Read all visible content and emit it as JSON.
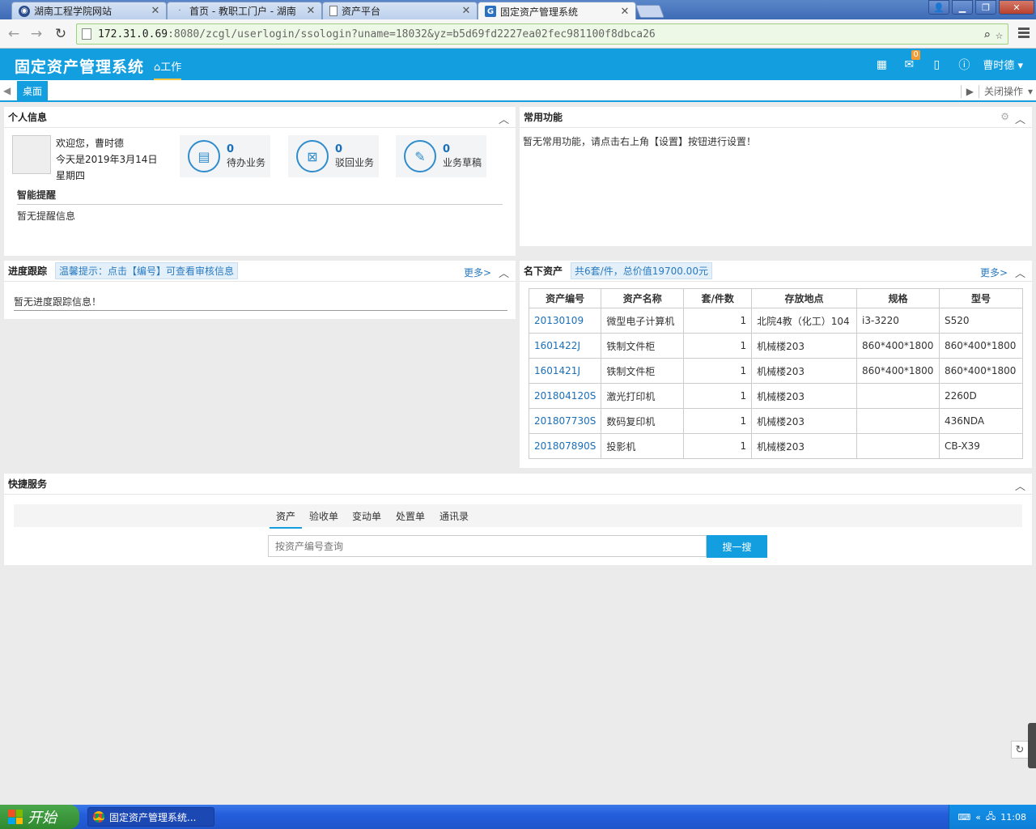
{
  "browser": {
    "tabs": [
      {
        "title": "湖南工程学院网站",
        "icon": "college-icon"
      },
      {
        "title": "首页 - 教职工门户 - 湖南",
        "icon": "loading-icon"
      },
      {
        "title": "资产平台",
        "icon": "page-icon"
      },
      {
        "title": "固定资产管理系统",
        "icon": "g-icon"
      }
    ],
    "url_host": "172.31.0.69",
    "url_rest": ":8080/zcgl/userlogin/ssologin?uname=18032&yz=b5d69fd2227ea02fec981100f8dbca26"
  },
  "app": {
    "title": "固定资产管理系统",
    "nav_work": "工作",
    "mail_badge": "0",
    "user_name": "曹时德",
    "desk_tab": "桌面",
    "close_ops": "关闭操作"
  },
  "personal": {
    "title": "个人信息",
    "welcome": "欢迎您，曹时德",
    "date": "今天是2019年3月14日",
    "weekday": "星期四",
    "cards": [
      {
        "count": "0",
        "label": "待办业务",
        "icon": "todo-icon"
      },
      {
        "count": "0",
        "label": "驳回业务",
        "icon": "reject-icon"
      },
      {
        "count": "0",
        "label": "业务草稿",
        "icon": "draft-icon"
      }
    ],
    "remind_title": "智能提醒",
    "remind_body": "暂无提醒信息"
  },
  "common": {
    "title": "常用功能",
    "body": "暂无常用功能，请点击右上角【设置】按钮进行设置！"
  },
  "progress": {
    "title": "进度跟踪",
    "tip": "温馨提示：点击【编号】可查看审核信息",
    "more": "更多>",
    "body": "暂无进度跟踪信息！"
  },
  "assets": {
    "title": "名下资产",
    "summary": "共6套/件，总价值19700.00元",
    "more": "更多>",
    "headers": [
      "资产编号",
      "资产名称",
      "套/件数",
      "存放地点",
      "规格",
      "型号"
    ],
    "rows": [
      [
        "20130109",
        "微型电子计算机",
        "1",
        "北院4教（化工）104",
        "i3-3220",
        "S520"
      ],
      [
        "1601422J",
        "铁制文件柜",
        "1",
        "机械楼203",
        "860*400*1800",
        "860*400*1800"
      ],
      [
        "1601421J",
        "铁制文件柜",
        "1",
        "机械楼203",
        "860*400*1800",
        "860*400*1800"
      ],
      [
        "201804120S",
        "激光打印机",
        "1",
        "机械楼203",
        "",
        "2260D"
      ],
      [
        "201807730S",
        "数码复印机",
        "1",
        "机械楼203",
        "",
        "436NDA"
      ],
      [
        "201807890S",
        "投影机",
        "1",
        "机械楼203",
        "",
        "CB-X39"
      ]
    ]
  },
  "quick": {
    "title": "快捷服务",
    "tabs": [
      "资产",
      "验收单",
      "变动单",
      "处置单",
      "通讯录"
    ],
    "placeholder": "按资产编号查询",
    "button": "搜一搜"
  },
  "taskbar": {
    "start": "开始",
    "item": "固定资产管理系统...",
    "clock": "11:08"
  },
  "colors": {
    "brand_blue": "#139ee0",
    "link_blue": "#1a6fb8",
    "badge_orange": "#f39c33"
  }
}
